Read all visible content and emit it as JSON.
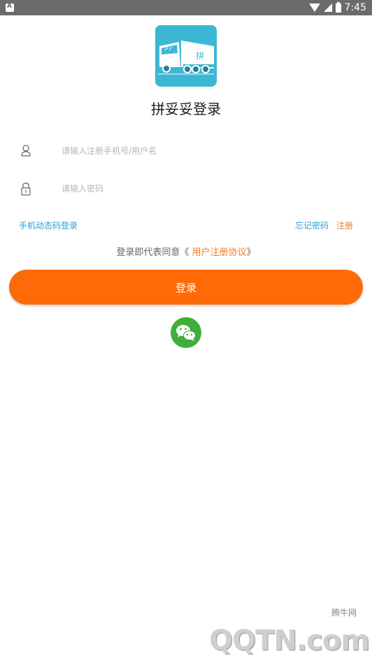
{
  "status_bar": {
    "time": "7:45"
  },
  "app": {
    "title": "拼妥妥登录",
    "logo_badge": "拼"
  },
  "form": {
    "phone_placeholder": "请输入注册手机号/用户名",
    "phone_value": "",
    "password_placeholder": "请输入密码",
    "password_value": ""
  },
  "links": {
    "sms_login": "手机动态码登录",
    "forgot_password": "忘记密码",
    "register": "注册"
  },
  "agreement": {
    "prefix": "登录即代表同意《 ",
    "link": "用户注册协议",
    "suffix": "》"
  },
  "login_button": {
    "label": "登录"
  },
  "watermark": {
    "brand": "腾牛网",
    "text": "QQTN.com"
  },
  "colors": {
    "primary_orange": "#fe6a07",
    "link_blue": "#2a9fd6",
    "accent_orange": "#f07a20",
    "logo_bg": "#3bb7d4",
    "wechat_green": "#3fae3a"
  },
  "icons": {
    "user": "user-icon",
    "lock": "lock-icon",
    "wechat": "wechat-icon"
  }
}
